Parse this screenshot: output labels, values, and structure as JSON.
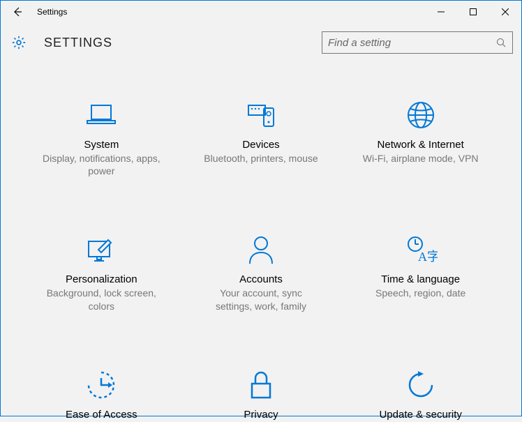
{
  "window": {
    "title": "Settings"
  },
  "header": {
    "title": "SETTINGS"
  },
  "search": {
    "placeholder": "Find a setting"
  },
  "tiles": [
    {
      "label": "System",
      "desc": "Display, notifications, apps, power"
    },
    {
      "label": "Devices",
      "desc": "Bluetooth, printers, mouse"
    },
    {
      "label": "Network & Internet",
      "desc": "Wi-Fi, airplane mode, VPN"
    },
    {
      "label": "Personalization",
      "desc": "Background, lock screen, colors"
    },
    {
      "label": "Accounts",
      "desc": "Your account, sync settings, work, family"
    },
    {
      "label": "Time & language",
      "desc": "Speech, region, date"
    },
    {
      "label": "Ease of Access",
      "desc": ""
    },
    {
      "label": "Privacy",
      "desc": ""
    },
    {
      "label": "Update & security",
      "desc": ""
    }
  ]
}
